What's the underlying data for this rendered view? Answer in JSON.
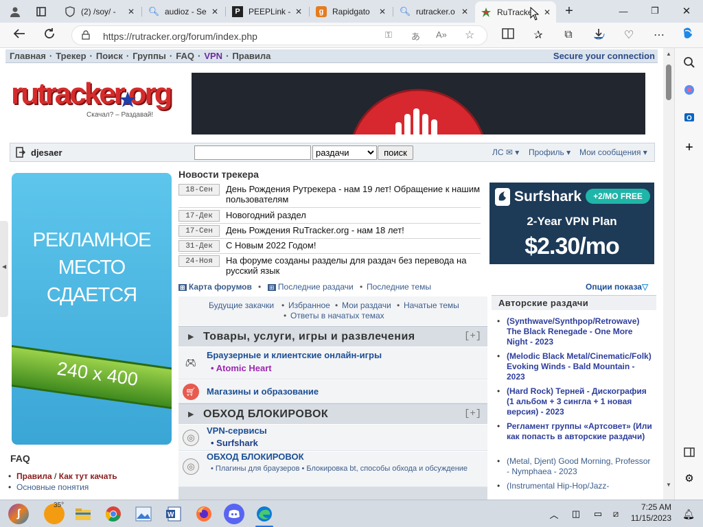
{
  "browser": {
    "tabs": [
      {
        "title": "",
        "icon": "profile-icon"
      },
      {
        "title": "",
        "icon": "tab-actions-icon"
      },
      {
        "title": "(2) /soy/ -",
        "icon": "shield-icon"
      },
      {
        "title": "audioz - Se",
        "icon": "search-icon"
      },
      {
        "title": "PEEPLink -",
        "icon": "peeplink-icon"
      },
      {
        "title": "Rapidgato",
        "icon": "rapidgator-icon"
      },
      {
        "title": "rutracker.o",
        "icon": "search-icon"
      },
      {
        "title": "RuTracke",
        "icon": "rutracker-icon"
      }
    ],
    "url": "https://rutracker.org/forum/index.php"
  },
  "nav": {
    "items": [
      "Главная",
      "Трекер",
      "Поиск",
      "Группы",
      "FAQ",
      "VPN",
      "Правила"
    ],
    "secure": "Secure your connection"
  },
  "logo": {
    "text": "rutracker.org",
    "slogan": "Скачал? – Раздавай!"
  },
  "userbar": {
    "username": "djesaer",
    "select_value": "раздачи",
    "search_button": "поиск",
    "ls": "ЛС",
    "profile": "Профиль",
    "messages": "Мои сообщения"
  },
  "left_ad": {
    "text_line1": "РЕКЛАМНОЕ",
    "text_line2": "МЕСТО",
    "text_line3": "СДАЕТСЯ",
    "size": "240 x 400"
  },
  "faq": {
    "title": "FAQ",
    "rules": "Правила",
    "sep": "/",
    "howto": "Как тут качать",
    "basics": "Основные понятия"
  },
  "news": {
    "title": "Новости трекера",
    "items": [
      {
        "date": "18-Сен",
        "text": "День Рождения Рутрекера - нам 19 лет! Обращение к нашим пользователям"
      },
      {
        "date": "17-Дек",
        "text": "Новогодний раздел"
      },
      {
        "date": "17-Сен",
        "text": "День Рождения RuTracker.org - нам 18 лет!"
      },
      {
        "date": "31-Дек",
        "text": "С Новым 2022 Годом!"
      },
      {
        "date": "24-Ноя",
        "text": "На форуме созданы разделы для раздач без перевода на русский язык"
      }
    ]
  },
  "surfshark_ad": {
    "brand": "Surfshark",
    "promo": "+2/MO FREE",
    "plan": "2-Year VPN Plan",
    "price": "$2.30/mo"
  },
  "links": {
    "forum_map": "Карта форумов",
    "latest_releases": "Последние раздачи",
    "latest_topics": "Последние темы",
    "display_options": "Опции показа"
  },
  "quick_links": [
    "Будущие закачки",
    "Избранное",
    "Мои раздачи",
    "Начатые темы",
    "Ответы в начатых темах"
  ],
  "categories": [
    {
      "title": "Товары, услуги, игры и развлечения",
      "toggle": "[+]",
      "forums": [
        {
          "name": "Браузерные и клиентские онлайн-игры",
          "sub": [
            "Atomic Heart"
          ]
        },
        {
          "name": "Магазины и образование",
          "sub": []
        }
      ]
    },
    {
      "title": "ОБХОД БЛОКИРОВОК",
      "toggle": "[+]",
      "forums": [
        {
          "name": "VPN-сервисы",
          "sub": [
            "Surfshark"
          ]
        },
        {
          "name": "ОБХОД БЛОКИРОВОК",
          "sub": [
            "Плагины для браузеров",
            "Блокировка bt, способы обхода и обсуждение"
          ]
        }
      ]
    }
  ],
  "author_releases": {
    "title": "Авторские раздачи",
    "items": [
      "(Synthwave/Synthpop/Retrowave) The Black Renegade - One More Night - 2023",
      "(Melodic Black Metal/Cinematic/Folk) Evoking Winds - Bald Mountain - 2023",
      "(Hard Rock) Терней - Дискография (1 альбом + 3 сингла + 1 новая версия) - 2023",
      "Регламент группы «Артсовет» (Или как попасть в авторские раздачи)",
      "(Metal, Djent) Good Morning, Professor - Nymphaea - 2023",
      "(Instrumental Hip-Hop/Jazz-"
    ]
  },
  "taskbar": {
    "weather": "35°",
    "time": "7:25 AM",
    "date": "11/15/2023"
  },
  "colors": {
    "nav_bg": "#dbe3ec",
    "link": "#3b5d8c",
    "accent": "#1b4f95",
    "purple": "#9c27b0"
  }
}
